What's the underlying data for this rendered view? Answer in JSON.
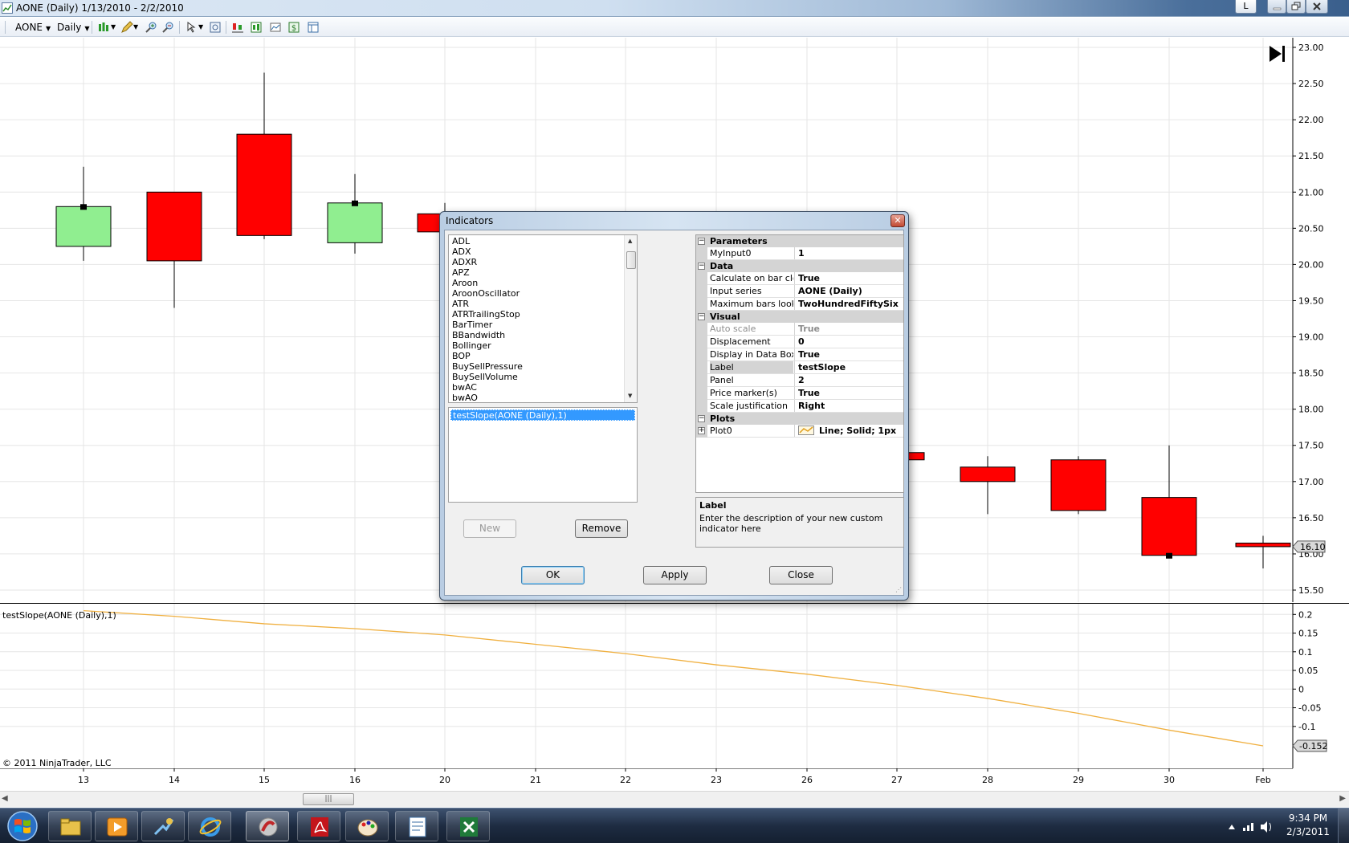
{
  "window": {
    "title": "AONE (Daily)  1/13/2010 - 2/2/2010",
    "link_button": "L",
    "icon": "chart-icon"
  },
  "toolbar": {
    "instrument": "AONE",
    "interval": "Daily",
    "icons": [
      "chart-style-icon",
      "pencil-draw-icon",
      "zoom-in-icon",
      "zoom-out-icon",
      "crosshair-icon",
      "properties-icon",
      "indicators-icon",
      "strategies-icon",
      "data-box-icon",
      "money-icon",
      "layout-icon"
    ]
  },
  "colors": {
    "up_candle": "#90ee90",
    "down_candle": "#ff0000",
    "indicator_line": "#f0b040",
    "grid": "#e6e6e6"
  },
  "chart_data": [
    {
      "type": "candlestick",
      "title": "AONE (Daily)",
      "ylim": [
        15.5,
        23.0
      ],
      "y_ticks": [
        "23.00",
        "22.50",
        "22.00",
        "21.50",
        "21.00",
        "20.50",
        "20.00",
        "19.50",
        "19.00",
        "18.50",
        "18.00",
        "17.50",
        "17.00",
        "16.50",
        "16.00",
        "15.50"
      ],
      "x_ticks": [
        "13",
        "14",
        "15",
        "16",
        "20",
        "21",
        "22",
        "23",
        "26",
        "27",
        "28",
        "29",
        "30",
        "Feb"
      ],
      "bars": [
        {
          "date": "13",
          "open": 20.25,
          "high": 21.35,
          "low": 20.05,
          "close": 20.8
        },
        {
          "date": "14",
          "open": 21.0,
          "high": 21.0,
          "low": 19.4,
          "close": 20.05
        },
        {
          "date": "15",
          "open": 21.8,
          "high": 22.65,
          "low": 20.35,
          "close": 20.4
        },
        {
          "date": "16",
          "open": 20.3,
          "high": 21.25,
          "low": 20.15,
          "close": 20.85
        },
        {
          "date": "20",
          "open": 20.7,
          "high": 20.85,
          "low": 20.4,
          "close": 20.45
        },
        {
          "date": "27",
          "open": 17.4,
          "high": 17.55,
          "low": 17.25,
          "close": 17.3
        },
        {
          "date": "28",
          "open": 17.2,
          "high": 17.35,
          "low": 16.55,
          "close": 17.0
        },
        {
          "date": "29",
          "open": 17.3,
          "high": 17.35,
          "low": 16.55,
          "close": 16.6
        },
        {
          "date": "30",
          "open": 16.78,
          "high": 17.5,
          "low": 15.95,
          "close": 15.98
        },
        {
          "date": "Feb",
          "open": 16.15,
          "high": 16.25,
          "low": 15.8,
          "close": 16.1
        }
      ],
      "last_price_label": "16.10"
    },
    {
      "type": "line",
      "series": [
        {
          "name": "testSlope(AONE (Daily),1)",
          "x": [
            "13",
            "14",
            "15",
            "16",
            "20",
            "21",
            "22",
            "23",
            "26",
            "27",
            "28",
            "29",
            "30",
            "Feb"
          ],
          "values": [
            0.21,
            0.195,
            0.175,
            0.162,
            0.145,
            0.12,
            0.095,
            0.065,
            0.04,
            0.01,
            -0.025,
            -0.065,
            -0.11,
            -0.152
          ]
        }
      ],
      "ylim": [
        -0.18,
        0.22
      ],
      "y_ticks": [
        "0.2",
        "0.15",
        "0.1",
        "0.05",
        "0",
        "-0.05",
        "-0.1"
      ],
      "last_value_label": "-0.152"
    }
  ],
  "indicator_label": "testSlope(AONE (Daily),1)",
  "copyright": "© 2011 NinjaTrader, LLC",
  "dialog": {
    "title": "Indicators",
    "available": [
      "ADL",
      "ADX",
      "ADXR",
      "APZ",
      "Aroon",
      "AroonOscillator",
      "ATR",
      "ATRTrailingStop",
      "BarTimer",
      "BBandwidth",
      "Bollinger",
      "BOP",
      "BuySellPressure",
      "BuySellVolume",
      "bwAC",
      "bwAO"
    ],
    "applied": [
      "testSlope(AONE (Daily),1)"
    ],
    "buttons": {
      "new": "New",
      "remove": "Remove",
      "ok": "OK",
      "apply": "Apply",
      "close": "Close"
    },
    "properties": {
      "parameters": {
        "title": "Parameters",
        "rows": [
          {
            "name": "MyInput0",
            "value": "1"
          }
        ]
      },
      "data": {
        "title": "Data",
        "rows": [
          {
            "name": "Calculate on bar close",
            "value": "True"
          },
          {
            "name": "Input series",
            "value": "AONE (Daily)"
          },
          {
            "name": "Maximum bars look back",
            "value": "TwoHundredFiftySix"
          }
        ]
      },
      "visual": {
        "title": "Visual",
        "rows": [
          {
            "name": "Auto scale",
            "value": "True"
          },
          {
            "name": "Displacement",
            "value": "0"
          },
          {
            "name": "Display in Data Box",
            "value": "True"
          },
          {
            "name": "Label",
            "value": "testSlope"
          },
          {
            "name": "Panel",
            "value": "2"
          },
          {
            "name": "Price marker(s)",
            "value": "True"
          },
          {
            "name": "Scale justification",
            "value": "Right"
          }
        ]
      },
      "plots": {
        "title": "Plots",
        "rows": [
          {
            "name": "Plot0",
            "value": "Line; Solid; 1px"
          }
        ]
      }
    },
    "help": {
      "title": "Label",
      "text": "Enter the description of your new custom indicator here"
    }
  },
  "taskbar": {
    "items": [
      "file-explorer-icon",
      "media-player-icon",
      "connect-icon",
      "internet-explorer-icon",
      "ninjatrader-icon",
      "acrobat-icon",
      "paint-icon",
      "document-icon",
      "excel-icon"
    ],
    "time": "9:34 PM",
    "date": "2/3/2011"
  }
}
